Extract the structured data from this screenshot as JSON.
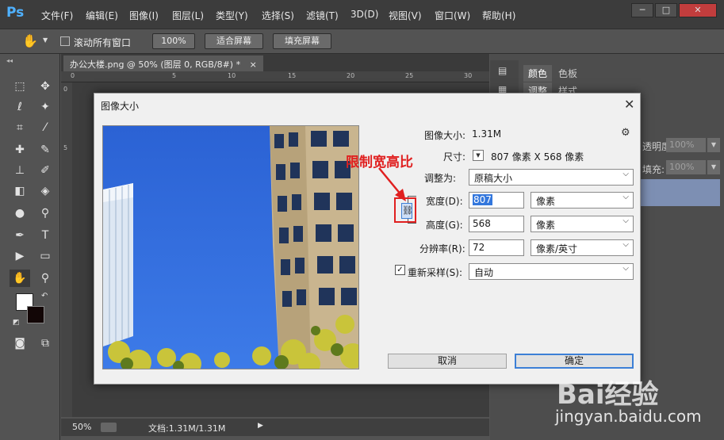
{
  "app": {
    "logo": "Ps",
    "menu": [
      "文件(F)",
      "编辑(E)",
      "图像(I)",
      "图层(L)",
      "类型(Y)",
      "选择(S)",
      "滤镜(T)",
      "3D(D)",
      "视图(V)",
      "窗口(W)",
      "帮助(H)"
    ],
    "window_buttons": {
      "minimize": "─",
      "maximize": "□",
      "close": "✕"
    }
  },
  "options_bar": {
    "scroll_all_label": "滚动所有窗口",
    "zoom_100": "100%",
    "fit_screen": "适合屏幕",
    "fill_screen": "填充屏幕"
  },
  "document": {
    "tab_title": "办公大楼.png @ 50% (图层 0, RGB/8#) *",
    "tab_close": "×",
    "ruler_ticks": [
      "0",
      "5",
      "10",
      "15",
      "20",
      "25",
      "30"
    ],
    "ruler_v_ticks": [
      "0",
      "5"
    ],
    "zoom": "50%",
    "doc_info": "文档:1.31M/1.31M"
  },
  "panels": {
    "tabs_row1": [
      "颜色",
      "色板"
    ],
    "tabs_row2": [
      "调整",
      "样式"
    ],
    "opacity_label": "透明度:",
    "opacity_value": "100%",
    "fill_label": "填充:",
    "fill_value": "100%"
  },
  "dialog": {
    "title": "图像大小",
    "close": "✕",
    "image_size_label": "图像大小:",
    "image_size_value": "1.31M",
    "dimensions_label": "尺寸:",
    "dimensions_value": "807 像素  X  568 像素",
    "fit_to_label": "调整为:",
    "fit_to_value": "原稿大小",
    "width_label": "宽度(D):",
    "width_value": "807",
    "width_unit": "像素",
    "height_label": "高度(G):",
    "height_value": "568",
    "height_unit": "像素",
    "resolution_label": "分辨率(R):",
    "resolution_value": "72",
    "resolution_unit": "像素/英寸",
    "resample_label": "重新采样(S):",
    "resample_value": "自动",
    "resample_checked": true,
    "cancel_label": "取消",
    "ok_label": "确定"
  },
  "annotation": {
    "text": "限制宽高比",
    "color": "#e02020"
  },
  "watermark": {
    "logo": "Bai经验",
    "url": "jingyan.baidu.com"
  },
  "colors": {
    "accent": "#3c7fd6",
    "annotation_red": "#e02020",
    "ps_blue": "#4fb1ff"
  }
}
